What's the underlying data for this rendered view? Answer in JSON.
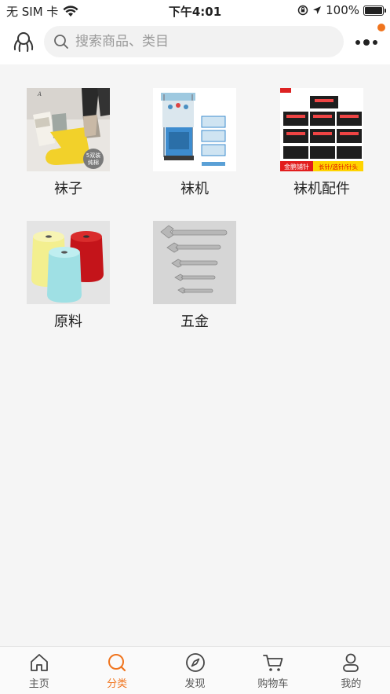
{
  "status_bar": {
    "carrier": "无 SIM 卡",
    "time": "下午4:01",
    "battery": "100%",
    "battery_level": 1.0
  },
  "header": {
    "search_placeholder": "搜索商品、类目",
    "accent_color": "#f0741d"
  },
  "categories": [
    {
      "label": "袜子",
      "image": "socks-image"
    },
    {
      "label": "袜机",
      "image": "sock-machine-image"
    },
    {
      "label": "袜机配件",
      "image": "machine-parts-image",
      "image_text": [
        "金鹏铺针",
        "长针/选针/针头"
      ]
    },
    {
      "label": "原料",
      "image": "yarn-image"
    },
    {
      "label": "五金",
      "image": "wrench-image"
    }
  ],
  "socks_badge": [
    "5双装",
    "纯棉"
  ],
  "tabs": [
    {
      "label": "主页",
      "icon": "home-icon",
      "active": false
    },
    {
      "label": "分类",
      "icon": "category-search-icon",
      "active": true
    },
    {
      "label": "发现",
      "icon": "compass-icon",
      "active": false
    },
    {
      "label": "购物车",
      "icon": "cart-icon",
      "active": false
    },
    {
      "label": "我的",
      "icon": "user-icon",
      "active": false
    }
  ]
}
